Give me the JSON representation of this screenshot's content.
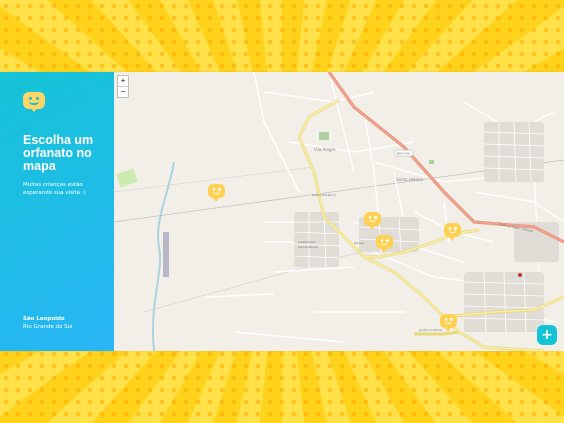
{
  "colors": {
    "accent": "#15C3D6",
    "accent_gradient_end": "#29B6F6",
    "marker": "#FFD152",
    "background": "#FFD60A",
    "highway": "#E8927C",
    "primary_road": "#F2E48A",
    "water": "#AAD3DF"
  },
  "sidebar": {
    "logo_icon": "happy-map-marker-icon",
    "title": "Escolha um orfanato no mapa",
    "subtitle": "Muitas crianças estão esperando sua visita :)",
    "city": "São Leopoldo",
    "state": "Rio Grande do Sul"
  },
  "map": {
    "zoom_in_label": "+",
    "zoom_out_label": "−",
    "labels": {
      "vila_alegre": "Vila Alegre",
      "santa_helena": "Santa Helena",
      "loteamento": "Loteamento",
      "garcia_neves": "Garcia Neves",
      "jardim_botanico": "Jardim Botânico",
      "parque": "Parque",
      "jardim_america": "Jardim América",
      "rodovia": "Rodovia Tabaí - Canoas",
      "brs": "BRS-448"
    },
    "marker_count": 5
  },
  "add_button": {
    "label": "+"
  }
}
